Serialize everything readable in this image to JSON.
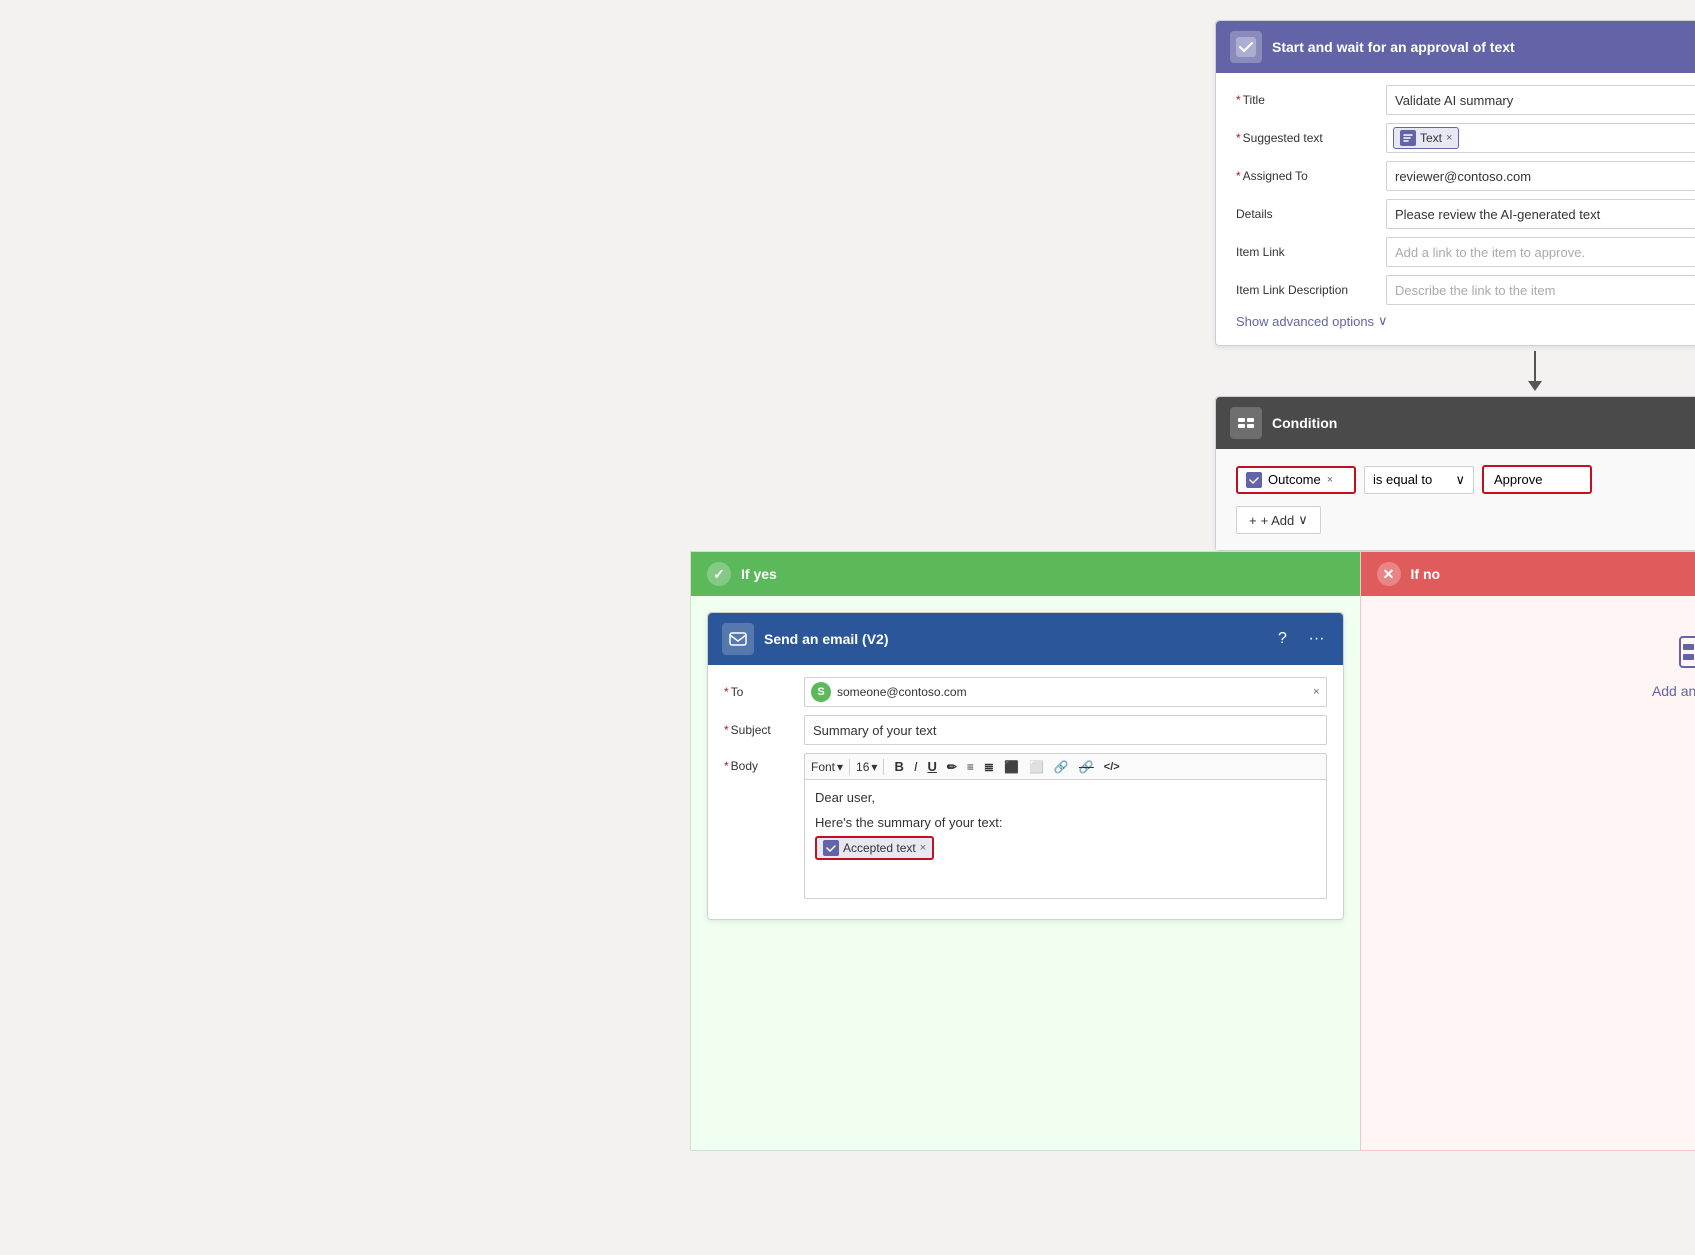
{
  "approval": {
    "header": {
      "title": "Start and wait for an approval of text",
      "icon": "✓",
      "help_icon": "?",
      "more_icon": "···"
    },
    "fields": {
      "title_label": "Title",
      "title_value": "Validate AI summary",
      "suggested_text_label": "Suggested text",
      "suggested_text_token": "Text",
      "assigned_to_label": "Assigned To",
      "assigned_to_value": "reviewer@contoso.com",
      "details_label": "Details",
      "details_value": "Please review the AI-generated text",
      "item_link_label": "Item Link",
      "item_link_placeholder": "Add a link to the item to approve.",
      "item_link_desc_label": "Item Link Description",
      "item_link_desc_placeholder": "Describe the link to the item",
      "show_advanced": "Show advanced options"
    }
  },
  "condition": {
    "header": {
      "title": "Condition",
      "more_icon": "···"
    },
    "outcome_label": "Outcome",
    "is_equal_to": "is equal to",
    "approve_value": "Approve",
    "add_label": "+ Add"
  },
  "if_yes": {
    "label": "If yes"
  },
  "if_no": {
    "label": "If no"
  },
  "email": {
    "header": {
      "title": "Send an email (V2)",
      "help_icon": "?",
      "more_icon": "···"
    },
    "to_label": "To",
    "to_value": "someone@contoso.com",
    "to_avatar": "S",
    "subject_label": "Subject",
    "subject_value": "Summary of your text",
    "body_label": "Body",
    "body_font": "Font",
    "body_font_size": "16",
    "body_line1": "Dear user,",
    "body_line2": "Here's the summary of your text:",
    "accepted_text_token": "Accepted text"
  },
  "add_action": {
    "label": "Add an action",
    "icon": "⊞"
  },
  "icons": {
    "approval_header": "✔",
    "condition_header": "⊞",
    "email_header": "✉",
    "chevron": "∨",
    "close": "×",
    "arrow_down": "↓"
  }
}
